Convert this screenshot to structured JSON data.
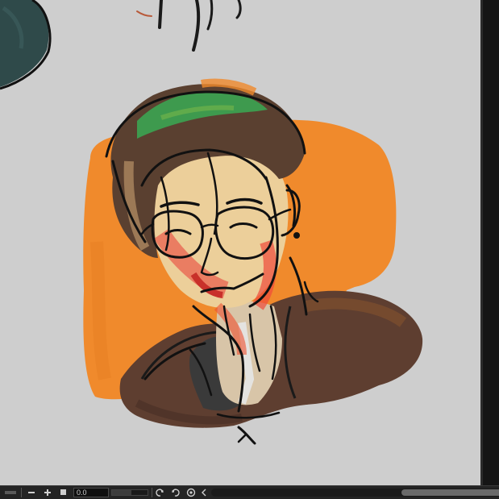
{
  "app": {
    "statusbar": {
      "zoom_out_icon": "minus-icon",
      "zoom_in_icon": "plus-icon",
      "fit_icon": "square-icon",
      "zoom_value": "0.0",
      "rotate_left_icon": "rotate-left-icon",
      "rotate_right_icon": "rotate-right-icon",
      "reset_icon": "reset-rotation-icon",
      "collapse_icon": "chevron-left-icon",
      "zoom_slider_level": 0.55
    }
  },
  "colors": {
    "canvas": "#cecece",
    "orange_block": "#f08a2c",
    "hair_green": "#3e9a4e",
    "shirt_brown": "#5e3e30",
    "ui_dark": "#242424"
  }
}
